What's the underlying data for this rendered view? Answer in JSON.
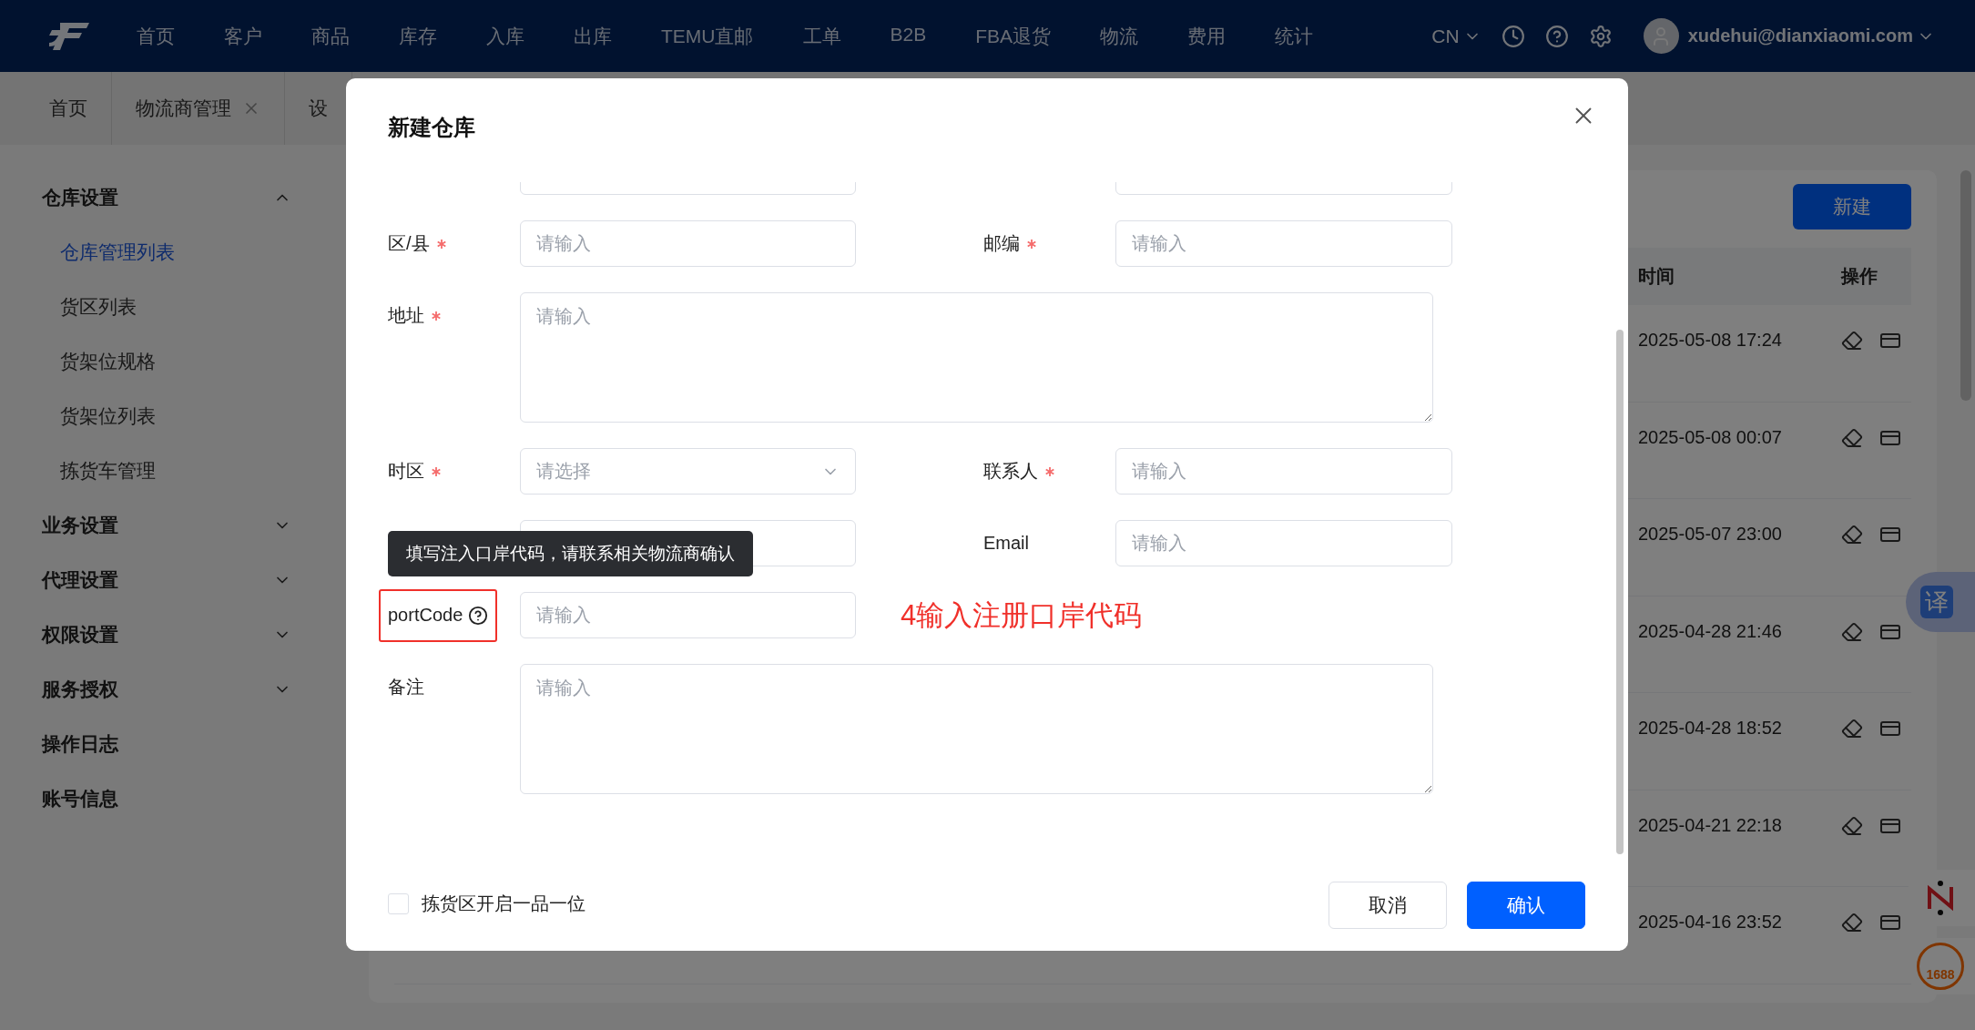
{
  "header": {
    "nav": [
      {
        "label": "首页"
      },
      {
        "label": "客户"
      },
      {
        "label": "商品"
      },
      {
        "label": "库存"
      },
      {
        "label": "入库"
      },
      {
        "label": "出库"
      },
      {
        "label": "TEMU直邮"
      },
      {
        "label": "工单"
      },
      {
        "label": "B2B"
      },
      {
        "label": "FBA退货"
      },
      {
        "label": "物流"
      },
      {
        "label": "费用"
      },
      {
        "label": "统计"
      }
    ],
    "language": "CN",
    "user": "xudehui@dianxiaomi.com"
  },
  "tabs": [
    {
      "label": "首页",
      "closable": false
    },
    {
      "label": "物流商管理",
      "closable": true
    },
    {
      "label": "设",
      "closable": false
    }
  ],
  "sidebar": [
    {
      "label": "仓库设置",
      "kind": "group",
      "expanded": true,
      "children": [
        {
          "label": "仓库管理列表",
          "selected": true
        },
        {
          "label": "货区列表",
          "selected": false
        },
        {
          "label": "货架位规格",
          "selected": false
        },
        {
          "label": "货架位列表",
          "selected": false
        },
        {
          "label": "拣货车管理",
          "selected": false
        }
      ]
    },
    {
      "label": "业务设置",
      "kind": "group",
      "expanded": false
    },
    {
      "label": "代理设置",
      "kind": "group",
      "expanded": false
    },
    {
      "label": "权限设置",
      "kind": "group",
      "expanded": false
    },
    {
      "label": "服务授权",
      "kind": "group",
      "expanded": false
    },
    {
      "label": "操作日志",
      "kind": "link"
    },
    {
      "label": "账号信息",
      "kind": "link"
    }
  ],
  "content": {
    "new_button": "新建",
    "table": {
      "columns": [
        "时间",
        "操作"
      ],
      "rows": [
        {
          "time": "2025-05-08 17:24"
        },
        {
          "time": "2025-05-08 00:07"
        },
        {
          "time": "2025-05-07 23:00"
        },
        {
          "time": "2025-04-28 21:46"
        },
        {
          "time": "2025-04-28 18:52"
        },
        {
          "time": "2025-04-21 22:18"
        },
        {
          "time": "2025-04-16 23:52"
        }
      ]
    }
  },
  "widgets": {
    "translate": "译",
    "badge": "1688"
  },
  "modal": {
    "title": "新建仓库",
    "rows": [
      [
        {
          "kind": "clipped"
        },
        {
          "kind": "clipped"
        }
      ],
      [
        {
          "kind": "input",
          "label": "区/县",
          "required": true,
          "placeholder": "请输入"
        },
        {
          "kind": "input",
          "label": "邮编",
          "required": true,
          "placeholder": "请输入"
        }
      ],
      [
        {
          "kind": "textarea",
          "label": "地址",
          "required": true,
          "placeholder": "请输入"
        }
      ],
      [
        {
          "kind": "select",
          "label": "时区",
          "required": true,
          "placeholder": "请选择"
        },
        {
          "kind": "input",
          "label": "联系人",
          "required": true,
          "placeholder": "请输入"
        }
      ],
      [
        {
          "kind": "covered"
        },
        {
          "kind": "input",
          "label": "Email",
          "required": false,
          "placeholder": "请输入"
        }
      ],
      [
        {
          "kind": "input",
          "label": "portCode",
          "required": false,
          "help": true,
          "highlighted": true,
          "placeholder": "请输入"
        }
      ],
      [
        {
          "kind": "textarea",
          "label": "备注",
          "required": false,
          "placeholder": "请输入"
        }
      ]
    ],
    "tooltip": "填写注入口岸代码，请联系相关物流商确认",
    "annotation": "4输入注册口岸代码",
    "checkbox": {
      "label": "拣货区开启一品一位",
      "checked": false
    },
    "buttons": [
      {
        "label": "取消",
        "kind": "default"
      },
      {
        "label": "确认",
        "kind": "primary"
      }
    ]
  }
}
